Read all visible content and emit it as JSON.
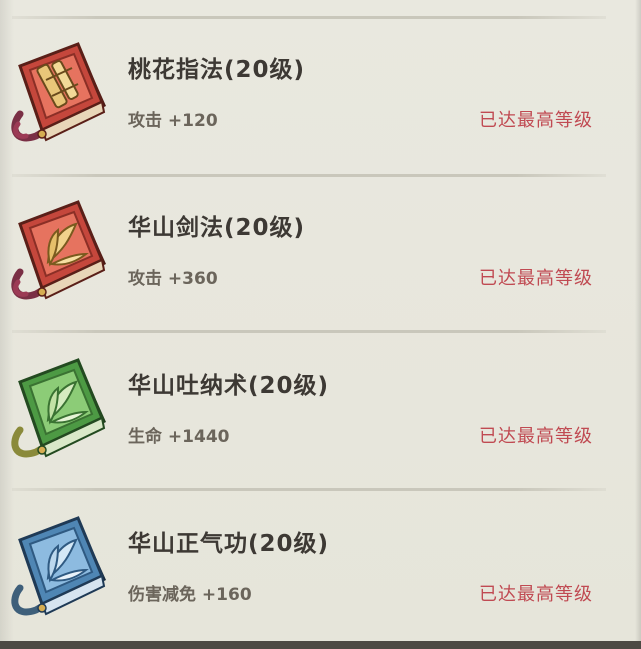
{
  "skills": [
    {
      "name": "桃花指法(20级)",
      "stat": "攻击 +120",
      "status": "已达最高等级",
      "icon": "peach-blossom-finger-manual-icon",
      "book_color": "#c2473d"
    },
    {
      "name": "华山剑法(20级)",
      "stat": "攻击 +360",
      "status": "已达最高等级",
      "icon": "huashan-sword-manual-icon",
      "book_color": "#c2473d"
    },
    {
      "name": "华山吐纳术(20级)",
      "stat": "生命 +1440",
      "status": "已达最高等级",
      "icon": "huashan-breathing-manual-icon",
      "book_color": "#4e9a45"
    },
    {
      "name": "华山正气功(20级)",
      "stat": "伤害减免 +160",
      "status": "已达最高等级",
      "icon": "huashan-righteous-qi-manual-icon",
      "book_color": "#4f86b4"
    }
  ],
  "colors": {
    "status_text": "#c04a52",
    "name_text": "#3d3934",
    "stat_text": "#6b655b",
    "background": "#e7e6dc"
  }
}
